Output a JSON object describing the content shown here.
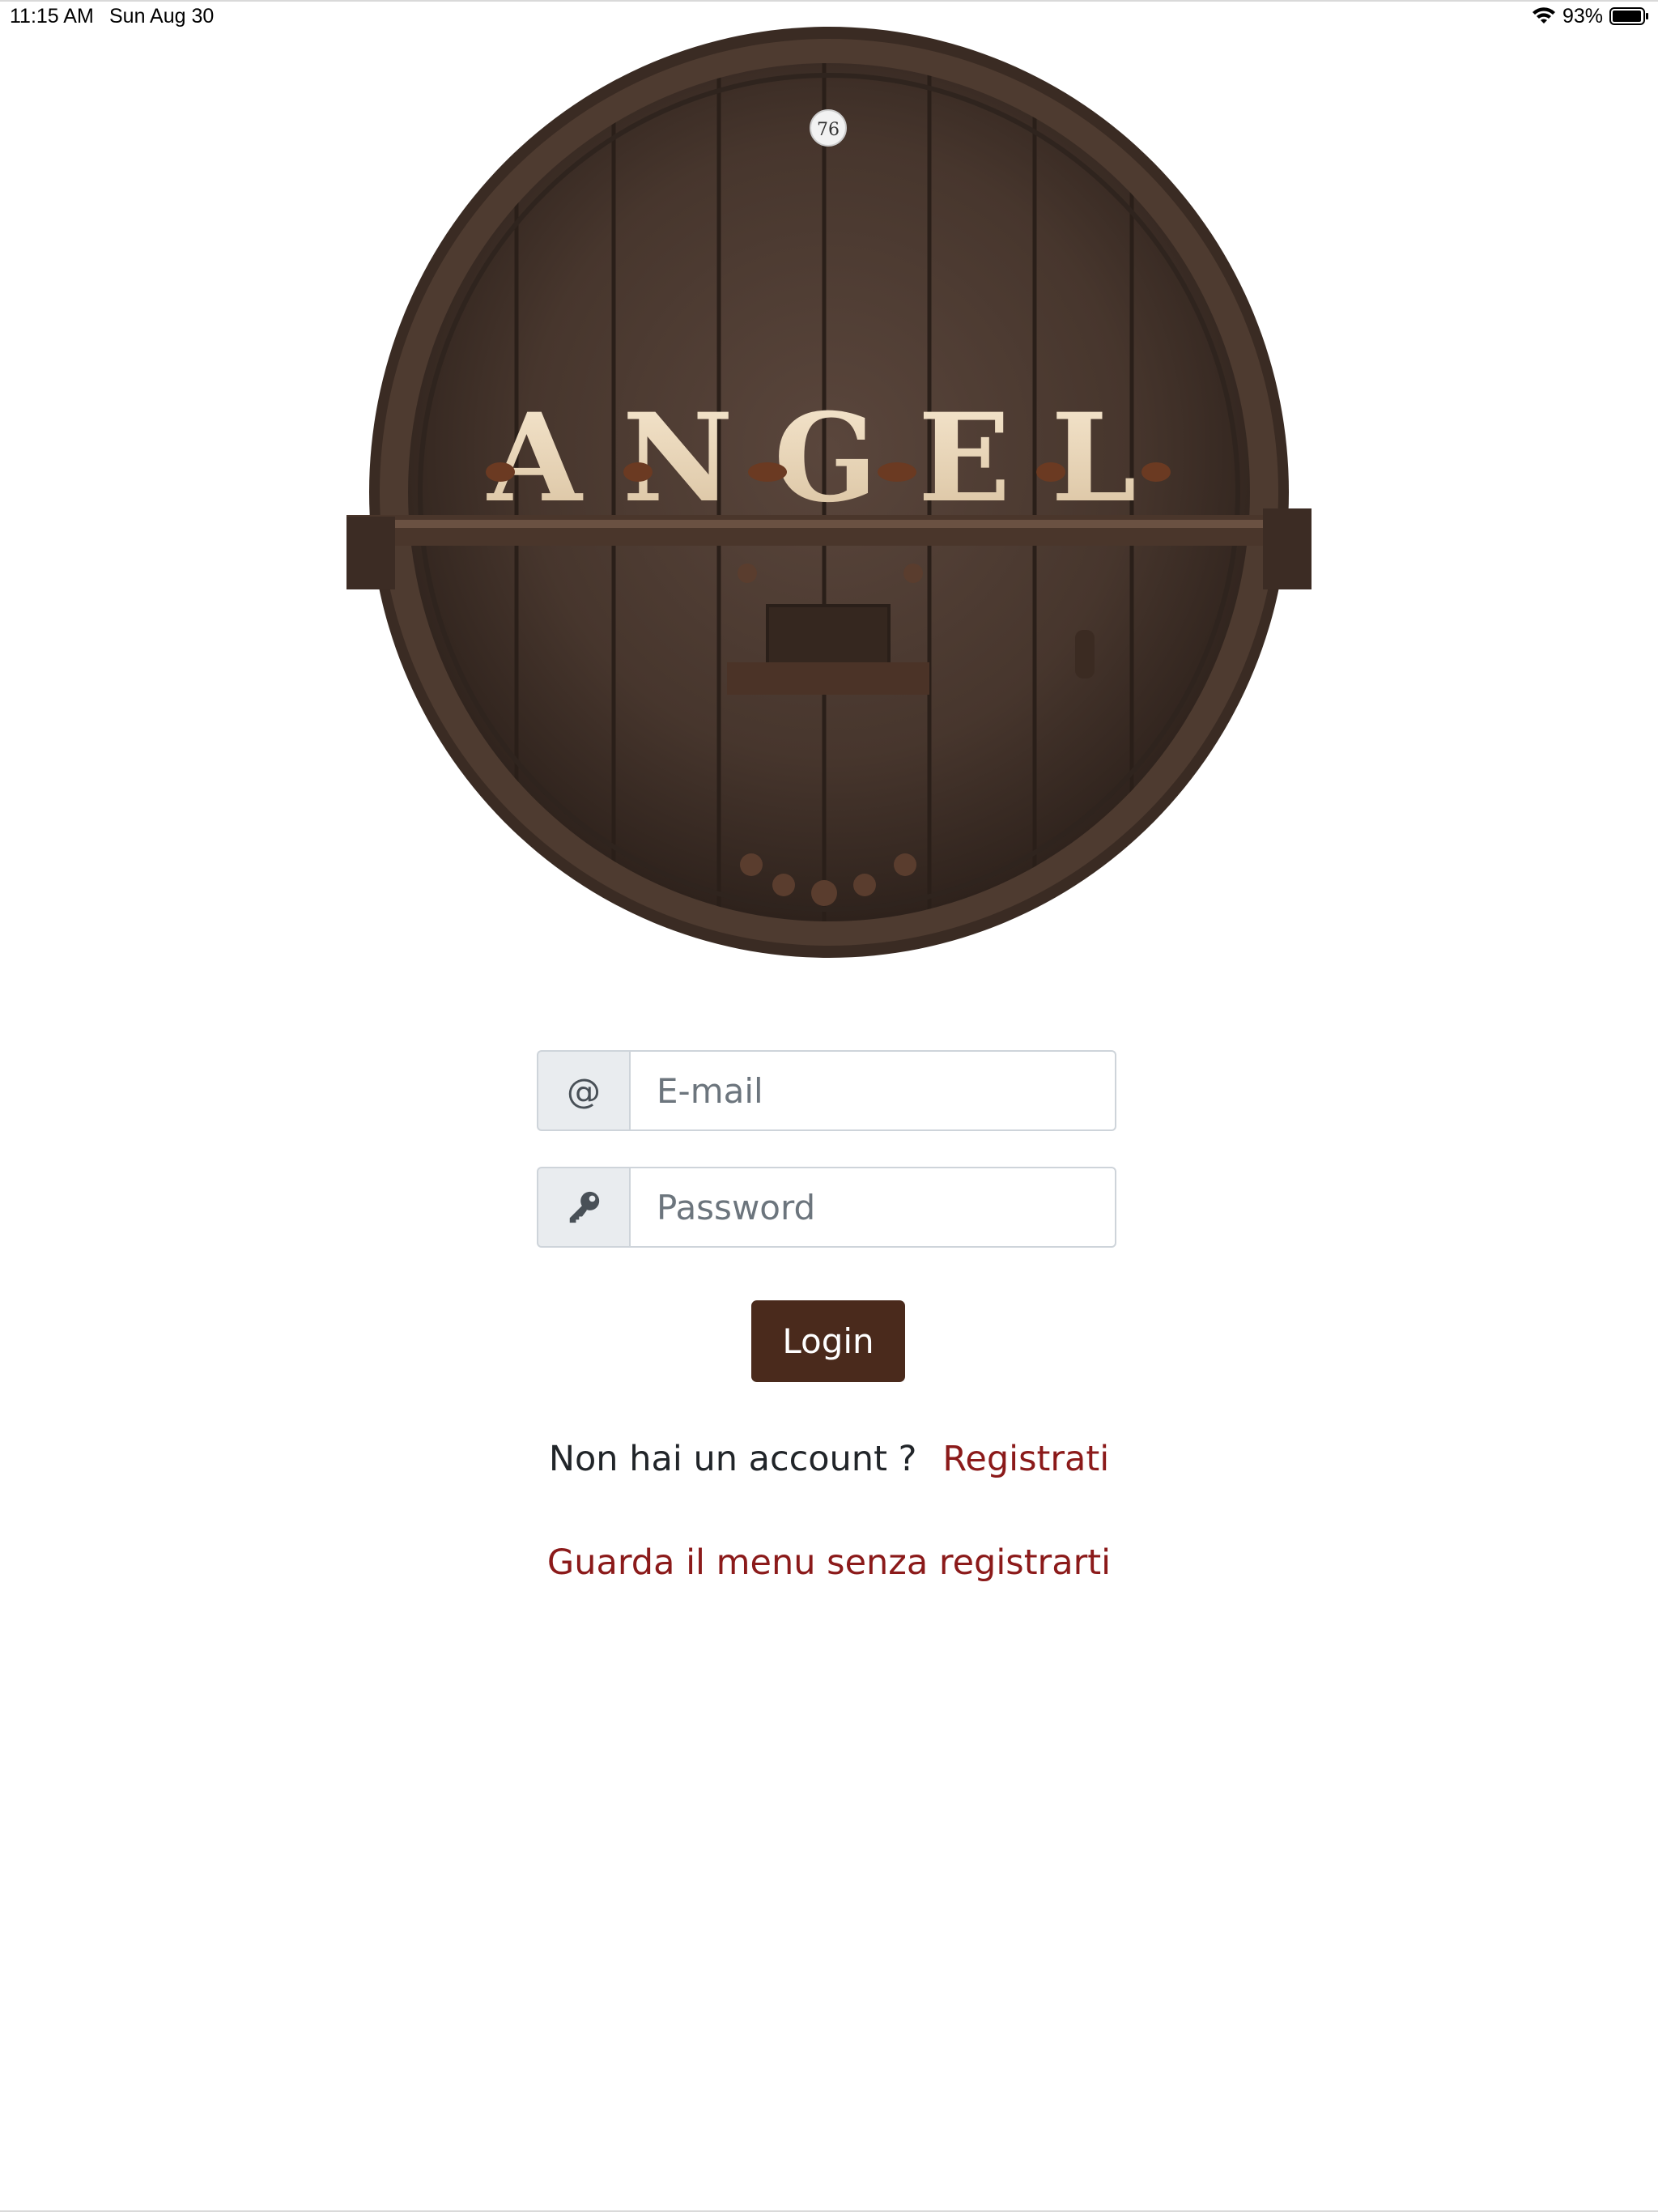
{
  "status_bar": {
    "time": "11:15 AM",
    "date": "Sun Aug 30",
    "battery": "93%",
    "icons": [
      "wifi-icon",
      "battery-icon"
    ]
  },
  "logo": {
    "brand_text": "ANGEL",
    "badge_text": "76"
  },
  "login_form": {
    "email_addon": "@",
    "email_placeholder": "E-mail",
    "email_value": "",
    "password_icon": "key-icon",
    "password_placeholder": "Password",
    "password_value": "",
    "login_label": "Login"
  },
  "signup": {
    "prompt": "Non hai un account ?",
    "link_label": "Registrati"
  },
  "guest": {
    "link_label": "Guarda il menu senza registrarti"
  },
  "colors": {
    "button_bg": "#4a2a1c",
    "link": "#8b1a1a",
    "addon_bg": "#e9ecef",
    "border": "#ced4da"
  }
}
